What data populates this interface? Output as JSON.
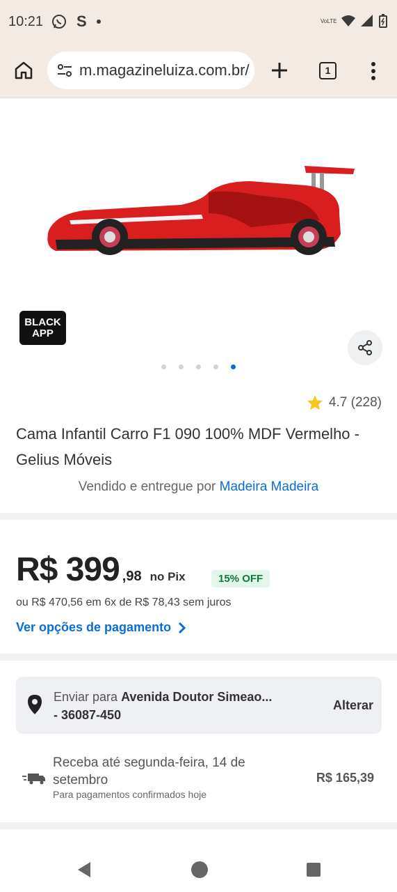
{
  "status": {
    "time": "10:21",
    "left_icons": [
      "whatsapp-icon",
      "s-icon",
      "dot-icon"
    ],
    "right_icons": [
      "volte-icon",
      "wifi-icon",
      "signal-icon",
      "battery-icon"
    ],
    "volte_label": "VoLTE",
    "s_glyph": "S"
  },
  "browser": {
    "url": "m.magazineluiza.com.br/",
    "tab_count": "1"
  },
  "product": {
    "badge_line1": "BLACK",
    "badge_line2": "APP",
    "rating": "4.7 (228)",
    "title": "Cama Infantil Carro F1 090 100% MDF Vermelho - Gelius Móveis",
    "seller_prefix": "Vendido e entregue por ",
    "seller_name": "Madeira Madeira",
    "carousel": {
      "total": 5,
      "active_index": 5
    }
  },
  "price": {
    "main": "R$ 399",
    "cents": ",98",
    "method": "no Pix",
    "discount": "15% OFF",
    "installments": "ou R$ 470,56 em 6x de R$ 78,43 sem juros",
    "options_link": "Ver opções de pagamento"
  },
  "shipping": {
    "prefix": "Enviar para ",
    "address": "Avenida Doutor Simeao...",
    "zip": "- 36087-450",
    "change": "Alterar",
    "delivery": "Receba até segunda-feira, 14 de setembro",
    "delivery_note": "Para pagamentos confirmados hoje",
    "cost": "R$ 165,39"
  },
  "colors": {
    "accent": "#0a6dd6",
    "browser_bg": "#f3ebe3",
    "car_red": "#d81e1e"
  }
}
